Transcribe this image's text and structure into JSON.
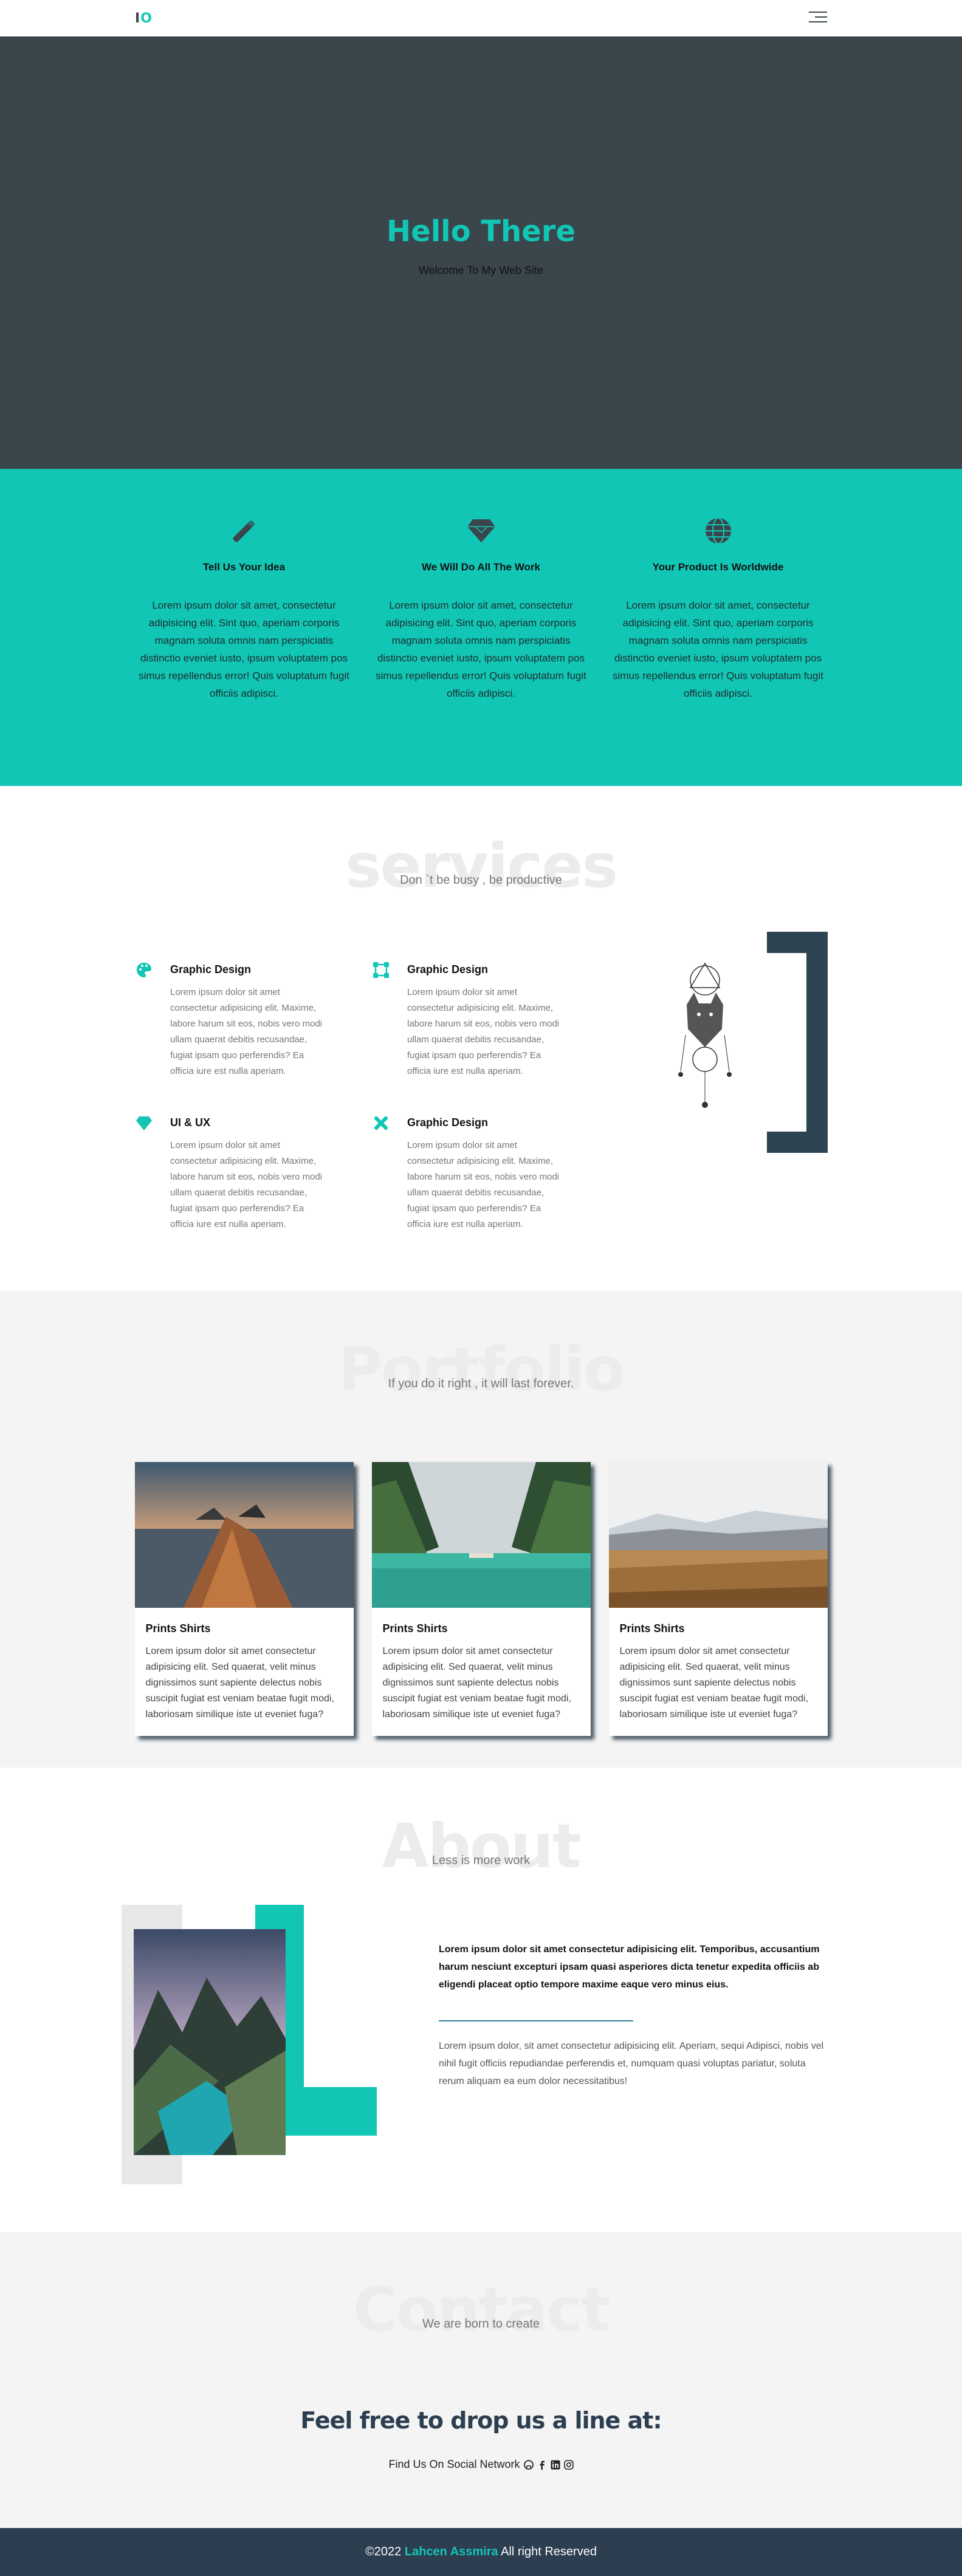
{
  "header": {
    "logo_left": "I",
    "logo_right": "O",
    "menu_icon": "hamburger-icon"
  },
  "hero": {
    "title": "Hello There",
    "subtitle": "Welcome To My Web Site"
  },
  "features": [
    {
      "icon": "pen-icon",
      "title": "Tell Us Your Idea",
      "text": "Lorem ipsum dolor sit amet, consectetur adipisicing elit. Sint quo, aperiam corporis magnam soluta omnis nam perspiciatis distinctio eveniet iusto, ipsum voluptatem pos simus repellendus error! Quis voluptatum fugit officiis adipisci."
    },
    {
      "icon": "diamond-icon",
      "title": "We Will Do All The Work",
      "text": "Lorem ipsum dolor sit amet, consectetur adipisicing elit. Sint quo, aperiam corporis magnam soluta omnis nam perspiciatis distinctio eveniet iusto, ipsum voluptatem pos simus repellendus error! Quis voluptatum fugit officiis adipisci."
    },
    {
      "icon": "globe-icon",
      "title": "Your Product Is Worldwide",
      "text": "Lorem ipsum dolor sit amet, consectetur adipisicing elit. Sint quo, aperiam corporis magnam soluta omnis nam perspiciatis distinctio eveniet iusto, ipsum voluptatem pos simus repellendus error! Quis voluptatum fugit officiis adipisci."
    }
  ],
  "services": {
    "heading": "services",
    "subheading": "Don `t be busy , be productive",
    "items": [
      {
        "icon": "palette-icon",
        "title": "Graphic Design",
        "text": "Lorem ipsum dolor sit amet consectetur adipisicing elit. Maxime, labore harum sit eos, nobis vero modi ullam quaerat debitis recusandae, fugiat ipsam quo perferendis? Ea officia iure est nulla aperiam."
      },
      {
        "icon": "vector-square-icon",
        "title": "Graphic Design",
        "text": "Lorem ipsum dolor sit amet consectetur adipisicing elit. Maxime, labore harum sit eos, nobis vero modi ullam quaerat debitis recusandae, fugiat ipsam quo perferendis? Ea officia iure est nulla aperiam."
      },
      {
        "icon": "gem-icon",
        "title": "UI & UX",
        "text": "Lorem ipsum dolor sit amet consectetur adipisicing elit. Maxime, labore harum sit eos, nobis vero modi ullam quaerat debitis recusandae, fugiat ipsam quo perferendis? Ea officia iure est nulla aperiam."
      },
      {
        "icon": "tools-icon",
        "title": "Graphic Design",
        "text": "Lorem ipsum dolor sit amet consectetur adipisicing elit. Maxime, labore harum sit eos, nobis vero modi ullam quaerat debitis recusandae, fugiat ipsam quo perferendis? Ea officia iure est nulla aperiam."
      }
    ]
  },
  "portfolio": {
    "heading": "Portfolio",
    "subheading": "If you do it right , it will last forever.",
    "cards": [
      {
        "title": "Prints Shirts",
        "text": "Lorem ipsum dolor sit amet consectetur adipisicing elit. Sed quaerat, velit minus dignissimos sunt sapiente delectus nobis suscipit fugiat est veniam beatae fugit modi, laboriosam similique iste ut eveniet fuga?"
      },
      {
        "title": "Prints Shirts",
        "text": "Lorem ipsum dolor sit amet consectetur adipisicing elit. Sed quaerat, velit minus dignissimos sunt sapiente delectus nobis suscipit fugiat est veniam beatae fugit modi, laboriosam similique iste ut eveniet fuga?"
      },
      {
        "title": "Prints Shirts",
        "text": "Lorem ipsum dolor sit amet consectetur adipisicing elit. Sed quaerat, velit minus dignissimos sunt sapiente delectus nobis suscipit fugiat est veniam beatae fugit modi, laboriosam similique iste ut eveniet fuga?"
      }
    ]
  },
  "about": {
    "heading": "About",
    "subheading": "Less is more work",
    "lead": "Lorem ipsum dolor sit amet consectetur adipisicing elit. Temporibus, accusantium harum nesciunt excepturi ipsam quasi asperiores dicta tenetur expedita officiis ab eligendi placeat optio tempore maxime eaque vero minus eius.",
    "body": "Lorem ipsum dolor, sit amet consectetur adipisicing elit. Aperiam, sequi Adipisci, nobis vel nihil fugit officiis repudiandae perferendis et, numquam quasi voluptas pariatur, soluta rerum aliquam ea eum dolor necessitatibus!"
  },
  "contact": {
    "heading": "Contact",
    "subheading": "We are born to create",
    "cta": "Feel free to drop us a line at:",
    "social_label": "Find Us On Social Network",
    "social_icons": [
      "github-icon",
      "facebook-icon",
      "linkedin-icon",
      "instagram-icon"
    ]
  },
  "footer": {
    "prefix": "©2022",
    "name": "Lahcen Assmira",
    "suffix": "All right Reserved"
  },
  "colors": {
    "accent": "#12c6b5",
    "dark": "#3a464c",
    "navy": "#2c3e50"
  }
}
